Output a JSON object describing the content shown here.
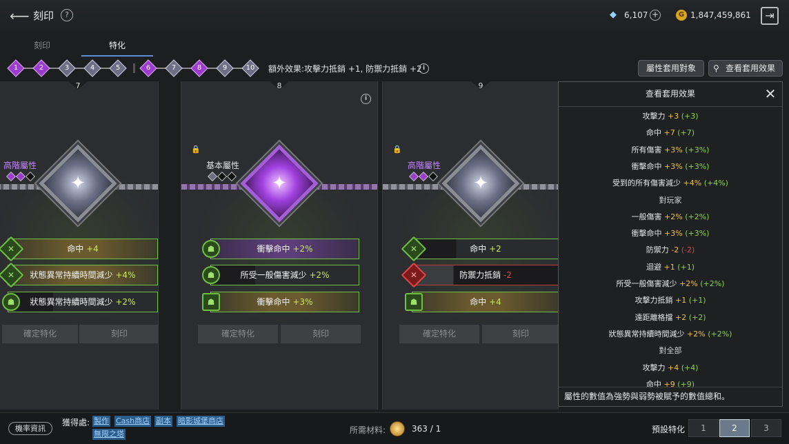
{
  "header": {
    "title": "刻印",
    "diamonds": "6,107",
    "gold": "1,847,459,861"
  },
  "tabs": [
    {
      "label": "刻印"
    },
    {
      "label": "特化"
    }
  ],
  "pips": [
    "1",
    "2",
    "3",
    "4",
    "5",
    "6",
    "7",
    "8",
    "9",
    "10"
  ],
  "extra_effect": "額外效果:攻擊力抵銷 +1, 防禦力抵銷 +2",
  "buttons": {
    "apply_target": "屬性套用對象",
    "view_effect": "查看套用效果"
  },
  "cards": [
    {
      "num": "7",
      "tier": "高階屬性",
      "stats": [
        {
          "name": "命中",
          "val": "+4"
        },
        {
          "name": "狀態異常持續時間減少",
          "val": "+4%"
        },
        {
          "name": "狀態異常持續時間減少",
          "val": "+2%"
        }
      ],
      "confirm": "確定特化",
      "engrave": "刻印"
    },
    {
      "num": "8",
      "tier": "基本屬性",
      "stats": [
        {
          "name": "衝擊命中",
          "val": "+2%"
        },
        {
          "name": "所受一般傷害減少",
          "val": "+2%"
        },
        {
          "name": "衝擊命中",
          "val": "+3%"
        }
      ],
      "confirm": "確定特化",
      "engrave": "刻印"
    },
    {
      "num": "9",
      "tier": "高階屬性",
      "stats": [
        {
          "name": "命中",
          "val": "+2"
        },
        {
          "name": "防禦力抵銷",
          "val": "-2"
        },
        {
          "name": "命中",
          "val": "+4"
        }
      ],
      "confirm": "確定特化",
      "engrave": "刻印"
    }
  ],
  "panel": {
    "title": "查看套用效果",
    "rows": [
      {
        "name": "攻擊力",
        "val": "+3",
        "paren": "(+3)"
      },
      {
        "name": "命中",
        "val": "+7",
        "paren": "(+7)"
      },
      {
        "name": "所有傷害",
        "val": "+3%",
        "paren": "(+3%)"
      },
      {
        "name": "衝擊命中",
        "val": "+3%",
        "paren": "(+3%)"
      },
      {
        "name": "受到的所有傷害減少",
        "val": "+4%",
        "paren": "(+4%)"
      },
      {
        "section": "對玩家"
      },
      {
        "name": "一般傷害",
        "val": "+2%",
        "paren": "(+2%)"
      },
      {
        "name": "衝擊命中",
        "val": "+3%",
        "paren": "(+3%)"
      },
      {
        "name": "防禦力",
        "val": "-2",
        "paren": "(-2)",
        "negative": true
      },
      {
        "name": "迴避",
        "val": "+1",
        "paren": "(+1)"
      },
      {
        "name": "所受一般傷害減少",
        "val": "+2%",
        "paren": "(+2%)"
      },
      {
        "name": "攻擊力抵銷",
        "val": "+1",
        "paren": "(+1)"
      },
      {
        "name": "遠距離格擋",
        "val": "+2",
        "paren": "(+2)"
      },
      {
        "name": "狀態異常持續時間減少",
        "val": "+2%",
        "paren": "(+2%)"
      },
      {
        "section": "對全部"
      },
      {
        "name": "攻擊力",
        "val": "+4",
        "paren": "(+4)"
      },
      {
        "name": "命中",
        "val": "+9",
        "paren": "(+9)"
      }
    ],
    "footer": "屬性的數值為強勢與弱勢被賦予的數值總和。"
  },
  "bottom": {
    "prob": "機率資訊",
    "obtain": "獲得處:",
    "sources": [
      "製作",
      "Cash商店",
      "副本",
      "暗影城堡商店",
      "無限之塔"
    ],
    "material_label": "所需材料:",
    "material_val": "363 / 1",
    "preset_label": "預設特化",
    "presets": [
      "1",
      "2",
      "3"
    ],
    "active_preset": 2
  }
}
